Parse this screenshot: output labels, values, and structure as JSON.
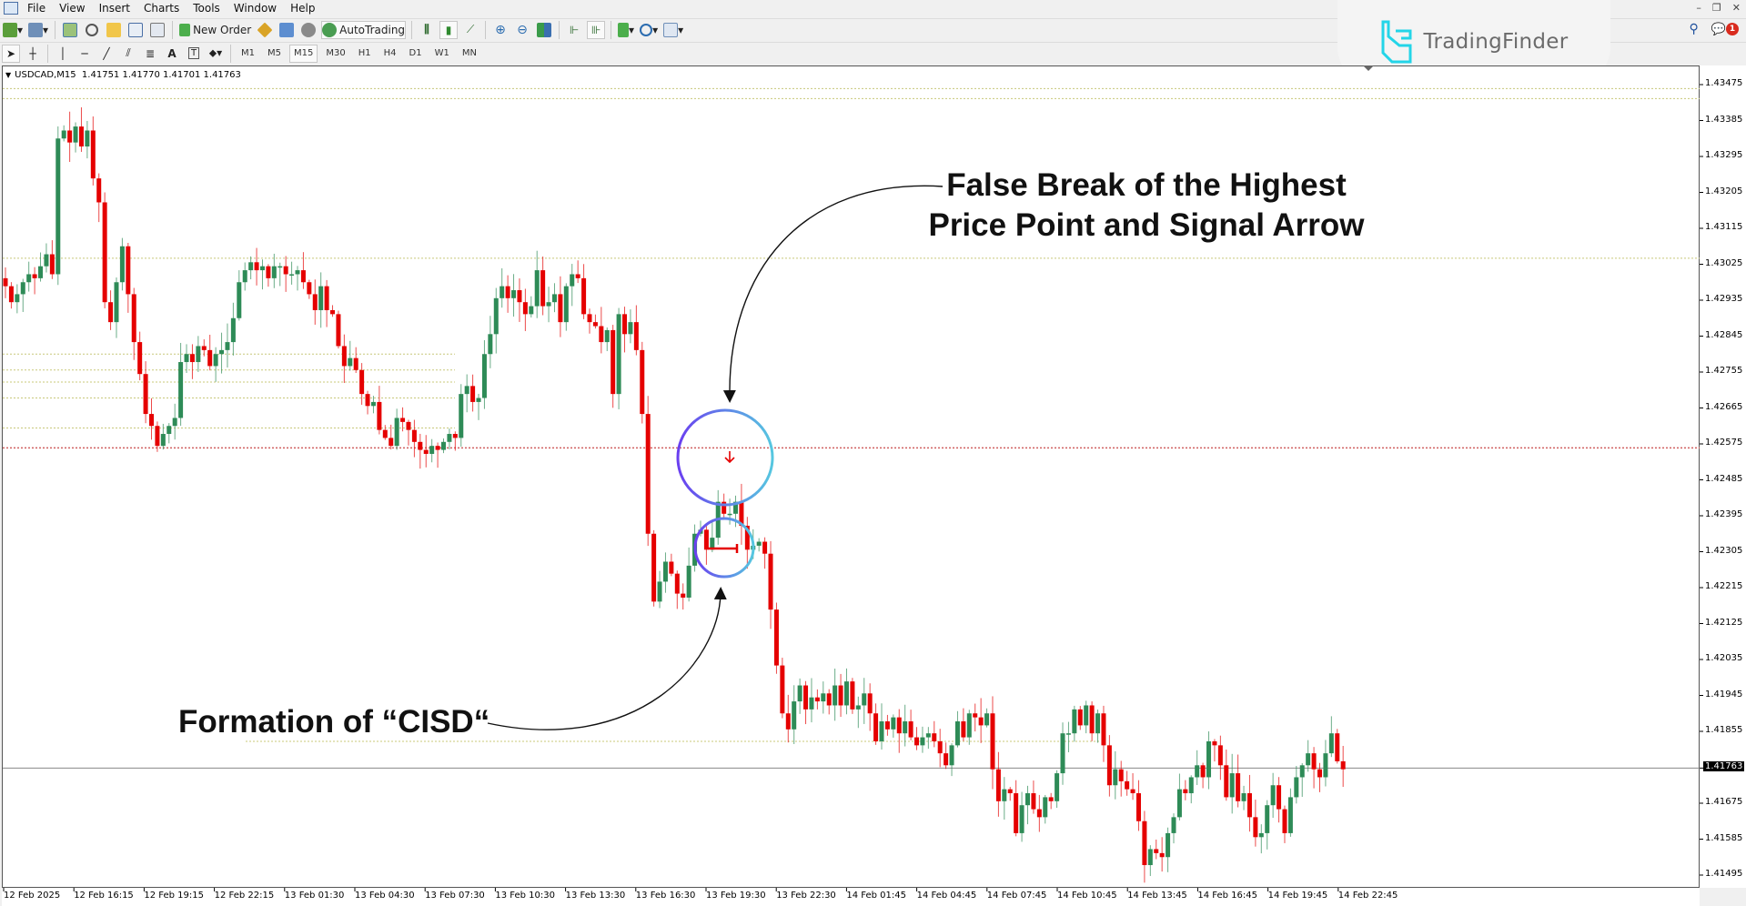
{
  "menu": [
    "File",
    "View",
    "Insert",
    "Charts",
    "Tools",
    "Window",
    "Help"
  ],
  "toolbar": {
    "new_order_label": "New Order",
    "autotrading_label": "AutoTrading",
    "icons": [
      "new-chart-icon",
      "profiles-icon",
      "market-watch-icon",
      "data-window-icon",
      "navigator-icon",
      "terminal-icon",
      "strategy-tester-icon",
      "new-order-icon",
      "metaeditor-icon",
      "market-icon",
      "signals-icon",
      "autotrading-icon",
      "bar-chart-icon",
      "candlestick-icon",
      "line-chart-icon",
      "zoom-in-icon",
      "zoom-out-icon",
      "tile-windows-icon",
      "chart-shift-icon",
      "autoscroll-icon",
      "indicators-icon",
      "periods-icon",
      "templates-icon"
    ]
  },
  "drawing_tools": [
    "cursor-icon",
    "crosshair-icon",
    "vertical-line-icon",
    "horizontal-line-icon",
    "trendline-icon",
    "fibonacci-icon",
    "channel-icon",
    "text-icon",
    "text-label-icon",
    "arrows-icon"
  ],
  "timeframes": [
    "M1",
    "M5",
    "M15",
    "M30",
    "H1",
    "H4",
    "D1",
    "W1",
    "MN"
  ],
  "active_timeframe": "M15",
  "brand": "TradingFinder",
  "notification_count": "1",
  "chart": {
    "symbol_line": "USDCAD,M15  1.41751 1.41770 1.41701 1.41763",
    "current_price": "1.41763"
  },
  "annotations": {
    "top_line1": "False Break of the Highest",
    "top_line2": "Price Point and Signal Arrow",
    "bottom": "Formation of “CISD“"
  },
  "colors": {
    "bull": "#2e8b57",
    "bear": "#e50000",
    "level_line": "#c8c87a",
    "red_level": "#d06060",
    "circle_start": "#6a3ff0",
    "circle_end": "#56c7e0",
    "brand_accent": "#23d5e8"
  },
  "chart_data": {
    "type": "candlestick",
    "symbol": "USDCAD",
    "timeframe": "M15",
    "ylim": [
      1.4145,
      1.4355
    ],
    "y_ticks": [
      "1.43475",
      "1.43385",
      "1.43295",
      "1.43205",
      "1.43115",
      "1.43025",
      "1.42935",
      "1.42845",
      "1.42755",
      "1.42665",
      "1.42575",
      "1.42485",
      "1.42395",
      "1.42305",
      "1.42215",
      "1.42125",
      "1.42035",
      "1.41945",
      "1.41855",
      "1.41763",
      "1.41675",
      "1.41585",
      "1.41495"
    ],
    "x_ticks": [
      "12 Feb 2025",
      "12 Feb 16:15",
      "12 Feb 19:15",
      "12 Feb 22:15",
      "13 Feb 01:30",
      "13 Feb 04:30",
      "13 Feb 07:30",
      "13 Feb 10:30",
      "13 Feb 13:30",
      "13 Feb 16:30",
      "13 Feb 19:30",
      "13 Feb 22:30",
      "14 Feb 01:45",
      "14 Feb 04:45",
      "14 Feb 07:45",
      "14 Feb 10:45",
      "14 Feb 13:45",
      "14 Feb 16:45",
      "14 Feb 19:45",
      "14 Feb 22:45"
    ],
    "levels": [
      1.43465,
      1.4344,
      1.4304,
      1.428,
      1.4276,
      1.4273,
      1.4269,
      1.42615,
      1.42565,
      1.4183
    ],
    "closes": [
      1.4297,
      1.4293,
      1.4295,
      1.4298,
      1.43,
      1.4299,
      1.4302,
      1.4305,
      1.43,
      1.4334,
      1.4336,
      1.4333,
      1.4337,
      1.4332,
      1.4336,
      1.4324,
      1.4318,
      1.4293,
      1.4288,
      1.4298,
      1.4307,
      1.4295,
      1.4283,
      1.4275,
      1.4265,
      1.4262,
      1.4257,
      1.426,
      1.4262,
      1.4264,
      1.4278,
      1.428,
      1.4278,
      1.4282,
      1.4281,
      1.4277,
      1.428,
      1.4281,
      1.4283,
      1.4289,
      1.4298,
      1.4301,
      1.4303,
      1.4301,
      1.4302,
      1.4299,
      1.4302,
      1.4302,
      1.43,
      1.43,
      1.4301,
      1.4298,
      1.4295,
      1.4291,
      1.4297,
      1.4291,
      1.429,
      1.4282,
      1.4277,
      1.4279,
      1.4276,
      1.427,
      1.4267,
      1.4268,
      1.4261,
      1.4259,
      1.4257,
      1.4264,
      1.4263,
      1.4261,
      1.4258,
      1.4256,
      1.4255,
      1.4257,
      1.4256,
      1.4258,
      1.426,
      1.4259,
      1.427,
      1.4272,
      1.4268,
      1.4269,
      1.428,
      1.4285,
      1.4294,
      1.4297,
      1.4294,
      1.4296,
      1.4293,
      1.429,
      1.4292,
      1.4301,
      1.4292,
      1.4293,
      1.4295,
      1.4288,
      1.4297,
      1.43,
      1.4299,
      1.429,
      1.4288,
      1.4287,
      1.4283,
      1.4286,
      1.427,
      1.429,
      1.4285,
      1.4288,
      1.4281,
      1.4265,
      1.4235,
      1.4218,
      1.4223,
      1.4228,
      1.4225,
      1.422,
      1.4219,
      1.4227,
      1.4235,
      1.4236,
      1.4231,
      1.4234,
      1.4243,
      1.424,
      1.424,
      1.4243,
      1.4237,
      1.4231,
      1.4232,
      1.4233,
      1.423,
      1.4216,
      1.4202,
      1.419,
      1.4186,
      1.4193,
      1.4197,
      1.4191,
      1.4194,
      1.4193,
      1.4195,
      1.4192,
      1.4197,
      1.4192,
      1.4198,
      1.4191,
      1.4192,
      1.4195,
      1.419,
      1.4183,
      1.4188,
      1.4186,
      1.4189,
      1.4185,
      1.4188,
      1.4184,
      1.4182,
      1.4184,
      1.4185,
      1.4183,
      1.418,
      1.4177,
      1.4182,
      1.4188,
      1.4184,
      1.419,
      1.4189,
      1.4187,
      1.419,
      1.4176,
      1.4168,
      1.4171,
      1.417,
      1.416,
      1.4167,
      1.417,
      1.4166,
      1.4164,
      1.4169,
      1.4168,
      1.4175,
      1.4185,
      1.4185,
      1.4191,
      1.4187,
      1.4192,
      1.4185,
      1.419,
      1.4182,
      1.4172,
      1.4176,
      1.4173,
      1.4171,
      1.417,
      1.4163,
      1.4152,
      1.4156,
      1.4155,
      1.4154,
      1.416,
      1.4164,
      1.4171,
      1.417,
      1.4174,
      1.4177,
      1.4174,
      1.4183,
      1.4182,
      1.4177,
      1.4169,
      1.4175,
      1.4168,
      1.417,
      1.4164,
      1.4159,
      1.416,
      1.4167,
      1.4172,
      1.4166,
      1.416,
      1.4169,
      1.4174,
      1.4177,
      1.418,
      1.4176,
      1.4174,
      1.418,
      1.4185,
      1.4178,
      1.4176
    ]
  }
}
